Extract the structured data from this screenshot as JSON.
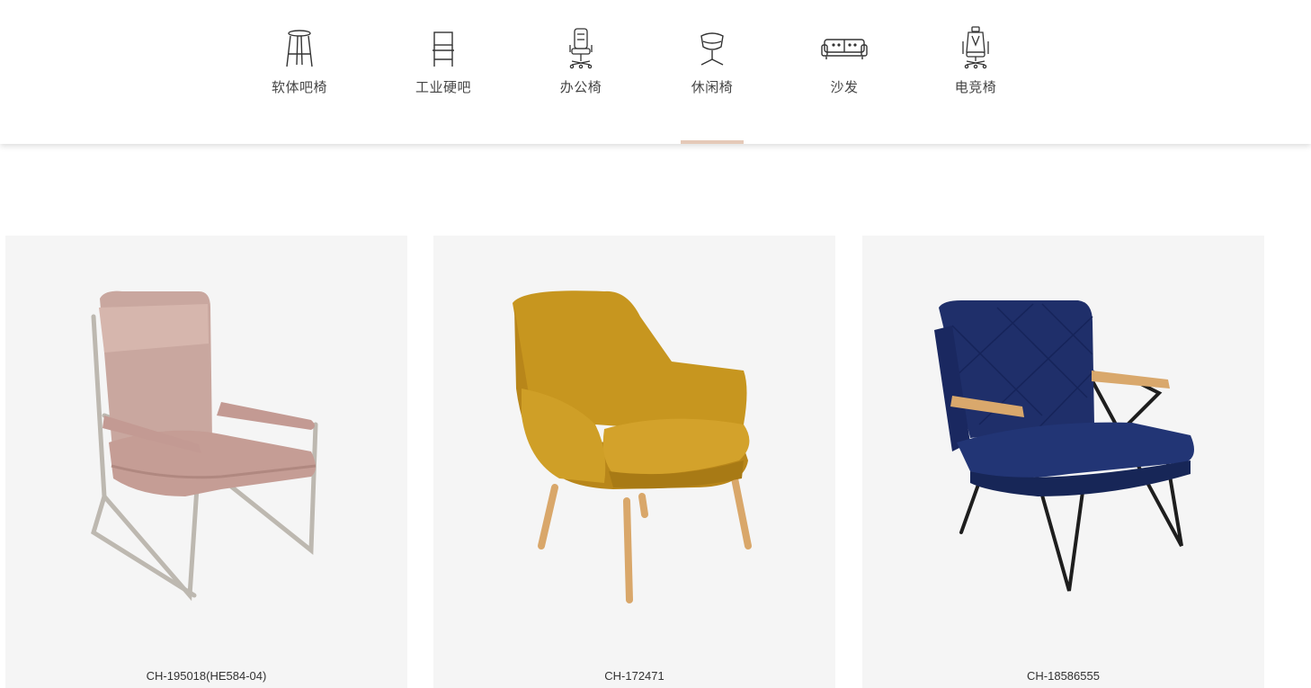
{
  "nav": {
    "items": [
      {
        "label": "软体吧椅",
        "icon": "bar-stool-icon"
      },
      {
        "label": "工业硬吧",
        "icon": "industrial-chair-icon"
      },
      {
        "label": "办公椅",
        "icon": "office-chair-icon"
      },
      {
        "label": "休闲椅",
        "icon": "swivel-chair-icon",
        "active": true
      },
      {
        "label": "沙发",
        "icon": "sofa-icon"
      },
      {
        "label": "电竞椅",
        "icon": "gaming-chair-icon"
      }
    ],
    "active_underline_color": "#e5c9b8"
  },
  "products": [
    {
      "code": "CH-195018(HE584-04)",
      "image": "pink-lounge-chair-image"
    },
    {
      "code": "CH-172471",
      "image": "mustard-armchair-image"
    },
    {
      "code": "CH-18586555",
      "image": "navy-velvet-chair-image"
    }
  ],
  "colors": {
    "card_background": "#f5f5f5",
    "text": "#333333"
  }
}
